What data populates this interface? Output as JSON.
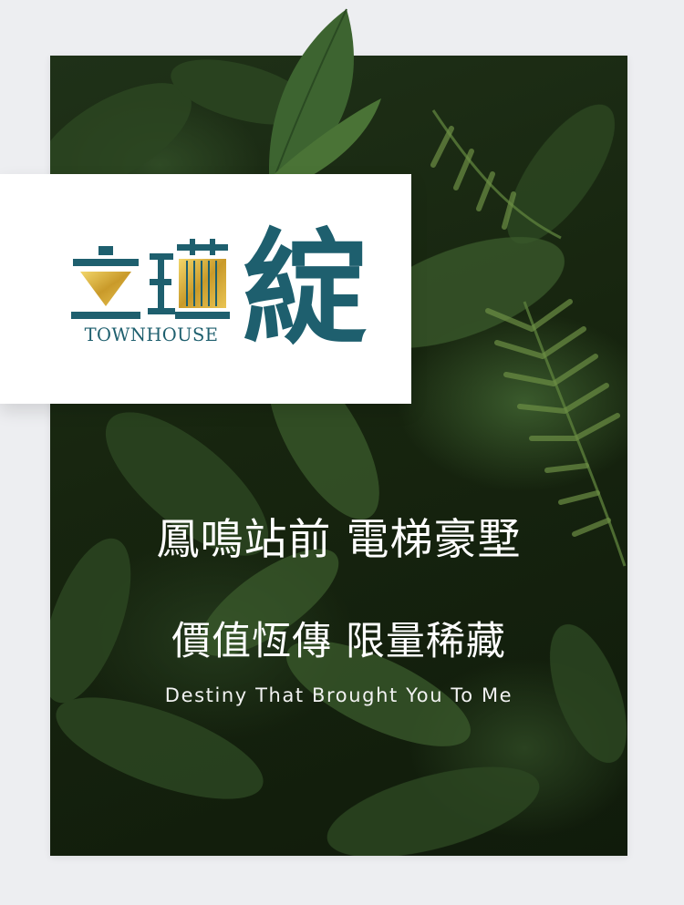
{
  "brand": {
    "name_glyphs": "立瑾",
    "subtitle": "TOWNHOUSE",
    "big_glyph": "綻",
    "primary_color": "#1e5f6e",
    "accent_color": "#d6b13a"
  },
  "headline": {
    "line1": "鳳鳴站前 電梯豪墅",
    "line2": "價值恆傳 限量稀藏"
  },
  "tagline": "Destiny That Brought You To Me",
  "background": {
    "page_color": "#edeef1",
    "foliage_color": "#1f3118"
  }
}
